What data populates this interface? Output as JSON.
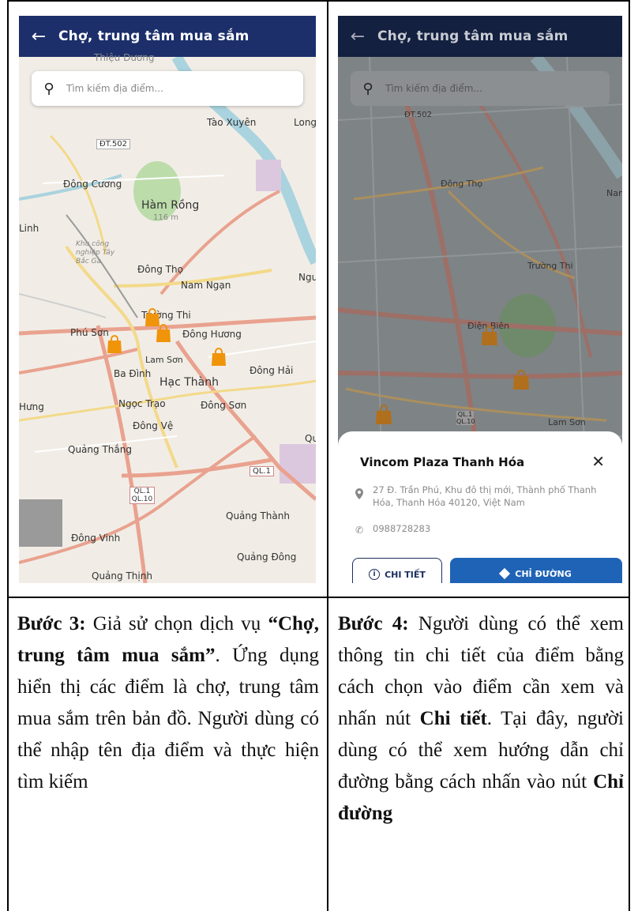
{
  "colors": {
    "appbar": "#1c2f6b",
    "marker": "#f0940a",
    "button_primary": "#1f63b6"
  },
  "left_screen": {
    "app_title": "Chợ, trung tâm mua sắm",
    "search_placeholder": "Tìm kiếm địa điểm...",
    "map_labels": [
      "Thiệu Dương",
      "Tào Xuyên",
      "Long",
      "ĐT.502",
      "Đông Cương",
      "Hàm Rồng",
      "116 m",
      "Linh",
      "Khu công nghiệp Tây Bắc Ga",
      "Đông Thọ",
      "Nam Ngạn",
      "Ngu",
      "Trường Thi",
      "Phú Sơn",
      "Đông Hương",
      "Lam Sơn",
      "Ba Đình",
      "Hạc Thành",
      "Đông Hải",
      "Hưng",
      "Ngọc Trạo",
      "Đông Sơn",
      "Đông Vệ",
      "Quảng Thắng",
      "QL.1",
      "QL.1 QL.10",
      "Quảng Thành",
      "Đông Vinh",
      "Quảng Đông",
      "Quảng Thịnh",
      "Qu"
    ]
  },
  "right_screen": {
    "app_title": "Chợ, trung tâm mua sắm",
    "search_placeholder": "Tìm kiếm địa điểm...",
    "map_labels": [
      "ĐT.502",
      "Đông Thọ",
      "Trường Thi",
      "Điện Biên",
      "Lam Sơn",
      "QL.1 QL.10",
      "Nam"
    ],
    "place_name": "Vincom Plaza Thanh Hóa",
    "address": "27 Đ. Trần Phú, Khu đô thị mới, Thành phố Thanh Hóa, Thanh Hóa 40120, Việt Nam",
    "phone": "0988728283",
    "detail_button": "CHI TIẾT",
    "directions_button": "CHỈ ĐƯỜNG"
  },
  "captions": {
    "step3": {
      "label": "Bước 3:",
      "t1": " Giả sử chọn dịch vụ ",
      "bold": "“Chợ, trung tâm mua sắm”",
      "t2": ". Ứng dụng hiển thị các điểm là chợ, trung tâm mua sắm trên bản đồ. Người dùng có thể nhập tên địa điểm và thực hiện tìm kiếm"
    },
    "step4": {
      "label": "Bước 4:",
      "t1": " Người dùng có thể xem thông tin chi tiết của điểm bằng cách chọn vào điểm cần xem và nhấn nút ",
      "bold1": "Chi tiết",
      "t2": ". Tại đây, người dùng có thể xem hướng dẫn chỉ đường bằng cách nhấn vào nút ",
      "bold2": "Chỉ đường"
    }
  }
}
